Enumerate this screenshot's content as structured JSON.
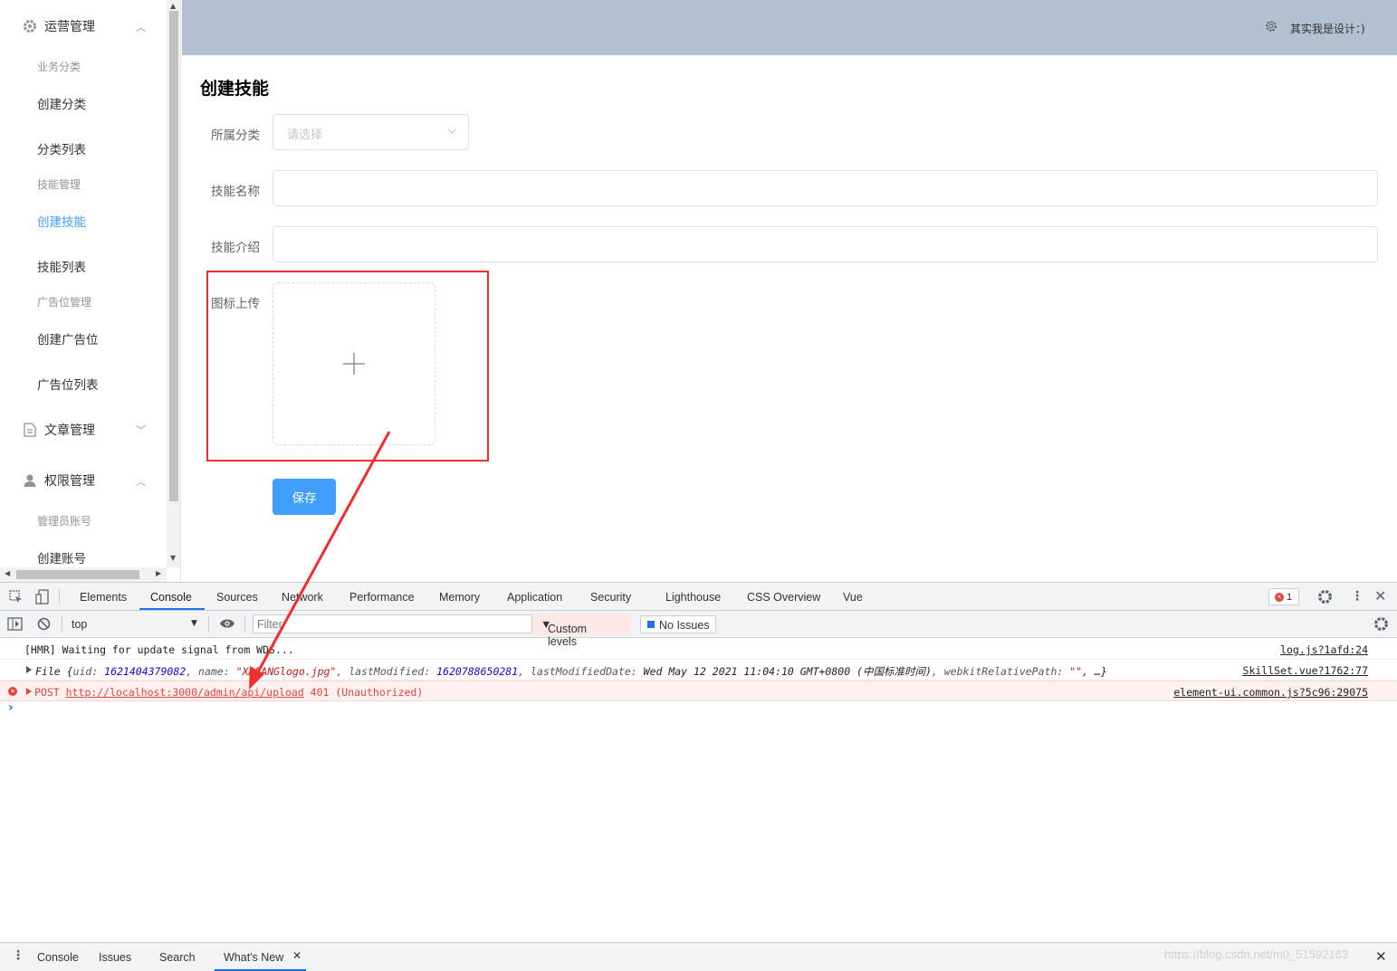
{
  "sidebar": {
    "groups": [
      {
        "title": "运营管理",
        "icon": "gear-icon",
        "expanded": true
      },
      {
        "title": "文章管理",
        "icon": "document-icon",
        "expanded": false
      },
      {
        "title": "权限管理",
        "icon": "user-icon",
        "expanded": true
      }
    ],
    "sections": [
      "业务分类",
      "技能管理",
      "广告位管理",
      "管理员账号"
    ],
    "items": [
      "创建分类",
      "分类列表",
      "创建技能",
      "技能列表",
      "创建广告位",
      "广告位列表",
      "创建账号"
    ],
    "active_item": "创建技能"
  },
  "header": {
    "user_text": "其实我是设计：)"
  },
  "form": {
    "title": "创建技能",
    "category_label": "所属分类",
    "category_placeholder": "请选择",
    "name_label": "技能名称",
    "intro_label": "技能介绍",
    "icon_label": "图标上传",
    "save_label": "保存"
  },
  "devtools": {
    "tabs": [
      "Elements",
      "Console",
      "Sources",
      "Network",
      "Performance",
      "Memory",
      "Application",
      "Security",
      "Lighthouse",
      "CSS Overview",
      "Vue"
    ],
    "active_tab": "Console",
    "error_count": "1",
    "context": "top",
    "filter_placeholder": "Filter",
    "levels": "Custom levels",
    "issues": "No Issues",
    "logs": {
      "hmr": {
        "text": "[HMR] Waiting for update signal from WDS...",
        "source": "log.js?1afd:24"
      },
      "file": {
        "prefix": "File {",
        "uid_key": "uid: ",
        "uid": "1621404379082",
        "name_key": ", name: ",
        "name": "\"XAFANGlogo.jpg\"",
        "lm_key": ", lastModified: ",
        "lm": "1620788650281",
        "lmd_key": ", lastModifiedDate: ",
        "lmd": "Wed May 12 2021 11:04:10 GMT+0800 (中国标准时间)",
        "wrp_key": ", webkitRelativePath: ",
        "wrp": "\"\"",
        "suffix": ", …}",
        "source": "SkillSet.vue?1762:77"
      },
      "error": {
        "method": "POST ",
        "url": "http://localhost:3000/admin/api/upload",
        "status": " 401 (Unauthorized)",
        "source": "element-ui.common.js?5c96:29075"
      }
    },
    "drawer_tabs": [
      "Console",
      "Issues",
      "Search",
      "What's New"
    ]
  },
  "watermark": "https://blog.csdn.net/m0_51592163",
  "colors": {
    "primary": "#409eff",
    "header_bg": "#b3c0d1",
    "highlight": "#ef2f2f",
    "error": "#e2463d"
  }
}
